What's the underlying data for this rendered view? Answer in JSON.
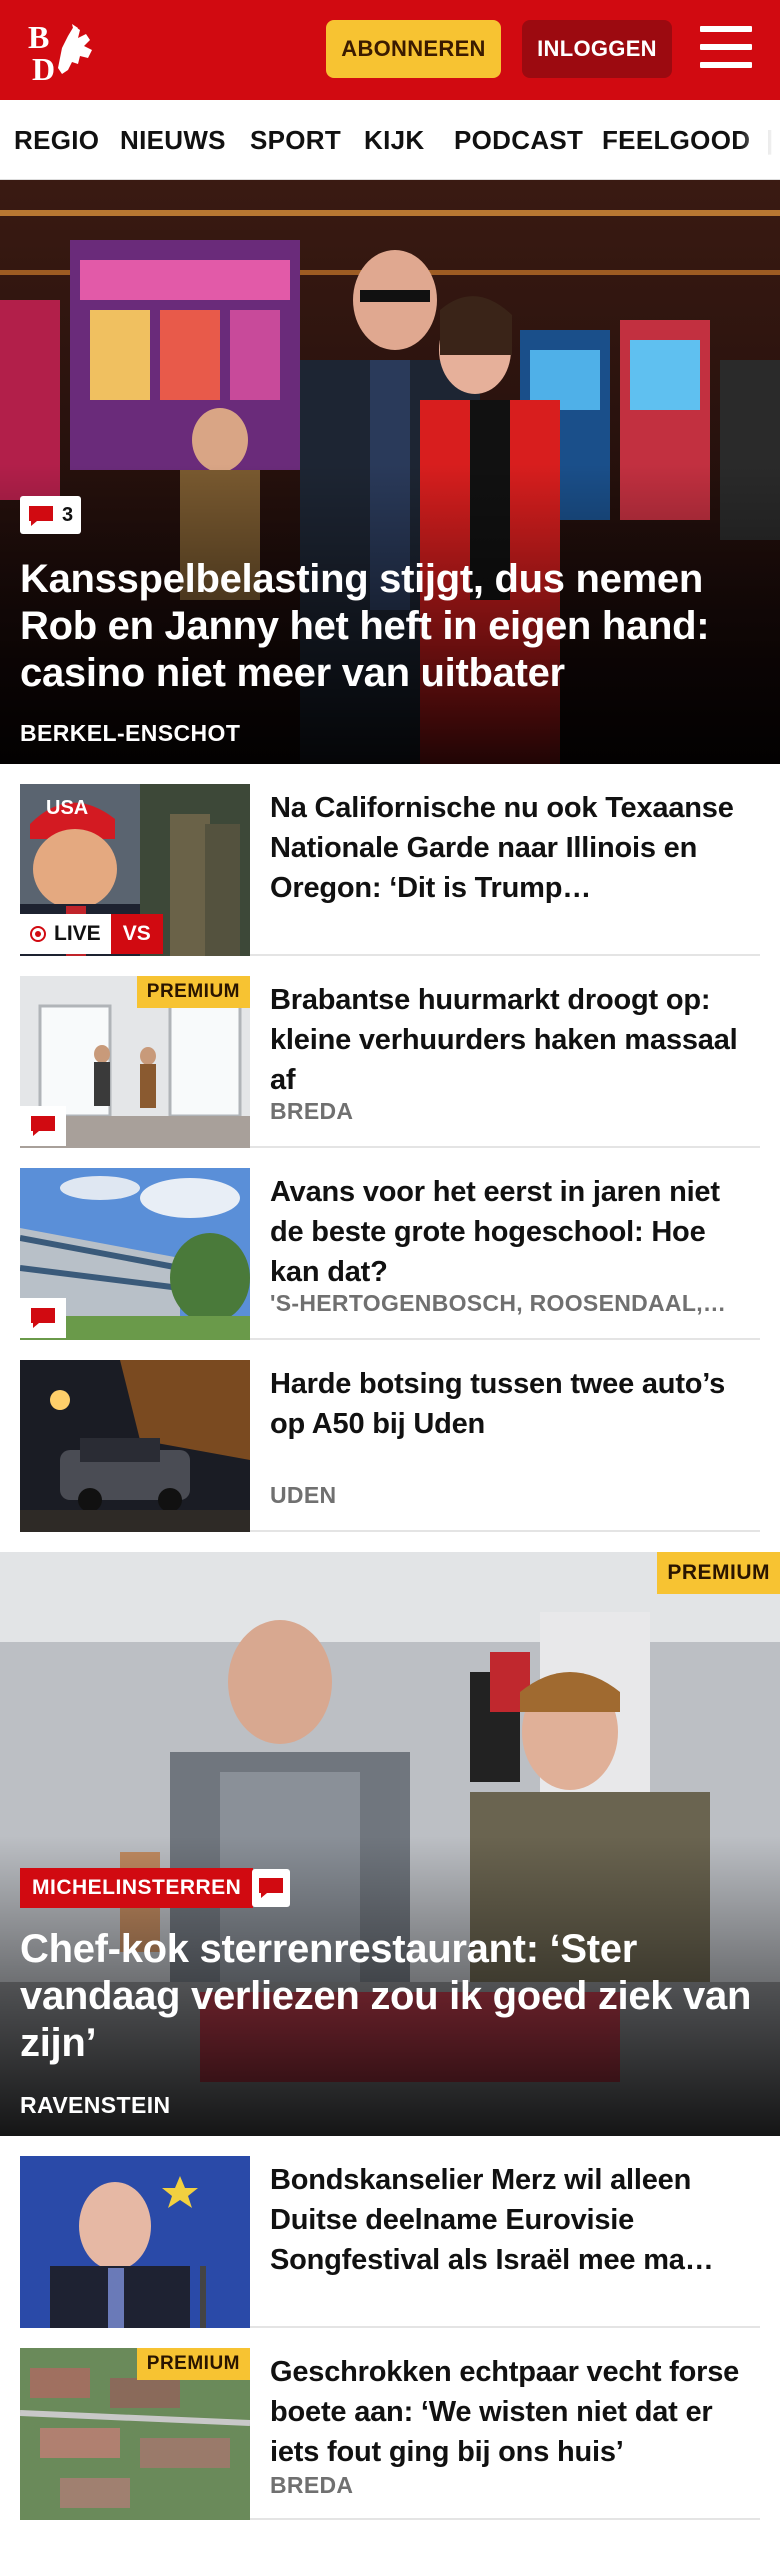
{
  "header": {
    "logo_text": "BD",
    "subscribe_label": "ABONNEREN",
    "login_label": "INLOGGEN",
    "menu_icon": "hamburger-menu-icon",
    "colors": {
      "brand": "#d10a11",
      "subscribe": "#f7c332",
      "login": "#9c0a10"
    }
  },
  "nav": {
    "items": [
      "REGIO",
      "NIEUWS",
      "SPORT",
      "KIJK",
      "PODCAST",
      "FEELGOOD"
    ]
  },
  "hero1": {
    "comments": "3",
    "title": "Kansspelbelasting stijgt, dus nemen Rob en Janny het heft in eigen hand: casino niet meer van uitbater",
    "location": "BERKEL-ENSCHOT"
  },
  "list1": [
    {
      "title": "Na Californische nu ook Texaanse Nationale Garde naar Illinois en Oregon: ‘Dit is Trump…",
      "live_label": "LIVE",
      "vs_label": "VS",
      "cap_text": "USA"
    },
    {
      "title": "Brabantse huurmarkt droogt op: kleine verhuurders haken massaal af",
      "location": "BREDA",
      "premium": "PREMIUM"
    },
    {
      "title": "Avans voor het eerst in jaren niet de beste grote hogeschool: Hoe kan dat?",
      "location": "'S-HERTOGENBOSCH, ROOSENDAAL,…"
    },
    {
      "title": "Harde botsing tussen twee auto’s op A50 bij Uden",
      "location": "UDEN"
    }
  ],
  "hero2": {
    "premium": "PREMIUM",
    "tag": "MICHELINSTERREN",
    "title": "Chef-kok sterrenrestaurant: ‘Ster vandaag verliezen zou ik goed ziek van zijn’",
    "location": "RAVENSTEIN"
  },
  "list2": [
    {
      "title": "Bondskanselier Merz wil alleen Duitse deelname Eurovisie Songfestival als Israël mee ma…"
    },
    {
      "title": "Geschrokken echtpaar vecht forse boete aan: ‘We wisten niet dat er iets fout ging bij ons huis’",
      "location": "BREDA",
      "premium": "PREMIUM"
    }
  ]
}
